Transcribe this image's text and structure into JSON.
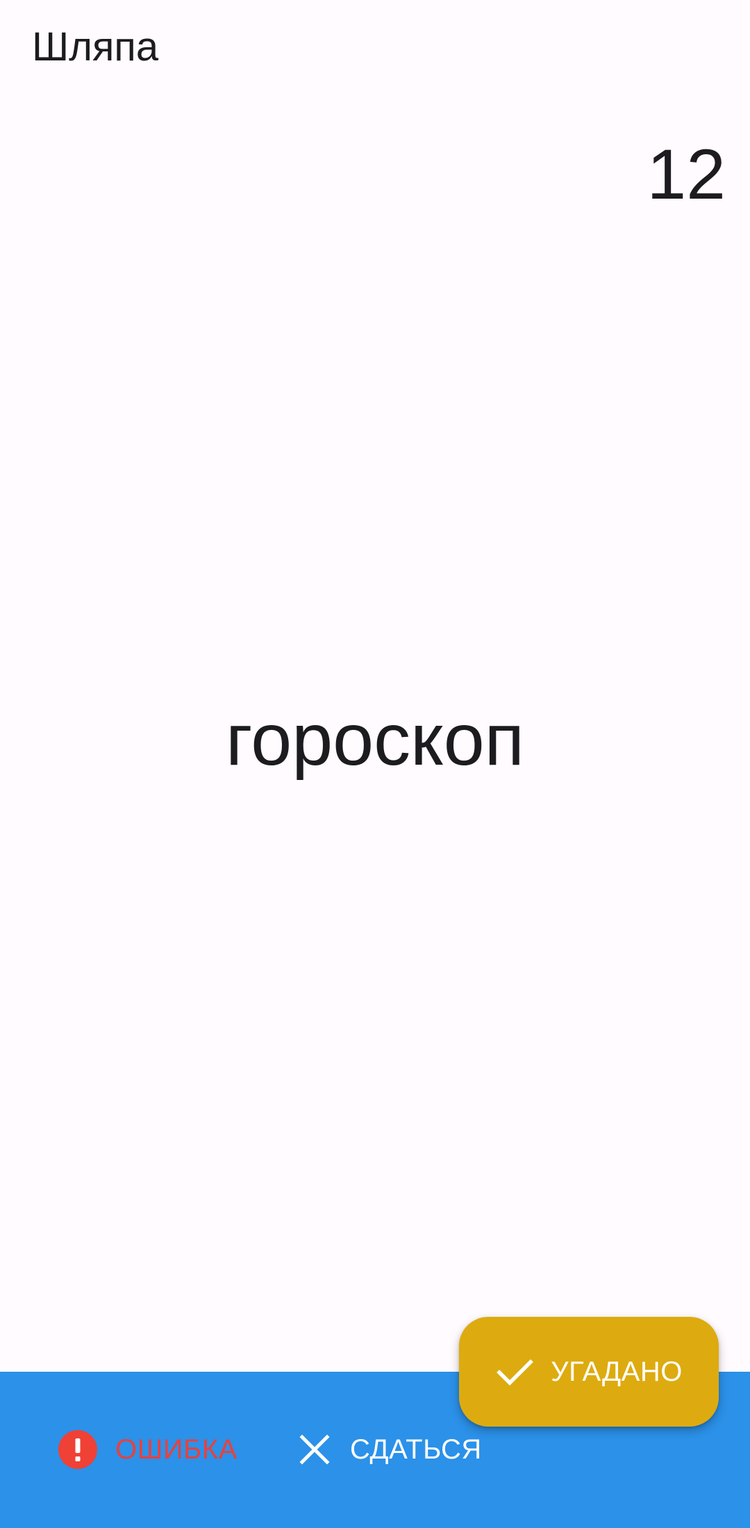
{
  "app": {
    "title": "Шляпа"
  },
  "game": {
    "timer": "12",
    "current_word": "гороскоп"
  },
  "actions": {
    "guessed_label": "УГАДАНО",
    "error_label": "ОШИБКА",
    "give_up_label": "СДАТЬСЯ"
  },
  "icons": {
    "guessed": "check-icon",
    "error": "error-icon",
    "give_up": "close-icon"
  },
  "colors": {
    "background": "#fffbfe",
    "bottom_bar": "#2b91e9",
    "fab": "#ddab0f",
    "error": "#ef4136",
    "text": "#1c1b1f"
  }
}
